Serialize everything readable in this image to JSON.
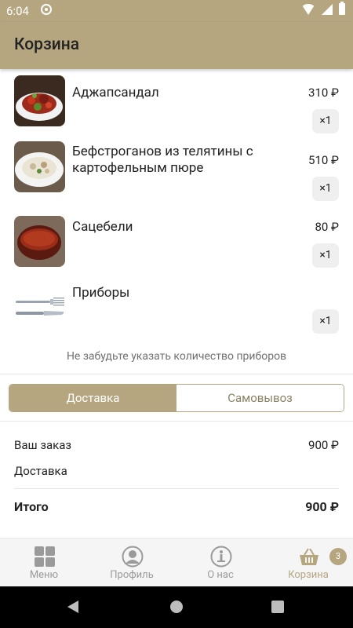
{
  "status_bar": {
    "time": "6:04"
  },
  "header": {
    "title": "Корзина"
  },
  "cart": {
    "items": [
      {
        "name": "Аджапсандал",
        "price": "310 ₽",
        "qty": "×1",
        "image": "ajapsandal-dish"
      },
      {
        "name": "Бефстроганов из телятины с картофельным пюре",
        "price": "510 ₽",
        "qty": "×1",
        "image": "beef-stroganoff-dish"
      },
      {
        "name": "Сацебели",
        "price": "80 ₽",
        "qty": "×1",
        "image": "satsebeli-sauce"
      },
      {
        "name": "Приборы",
        "price": "",
        "qty": "×1",
        "image": "cutlery"
      }
    ],
    "cutlery_note": "Не забудьте указать количество приборов"
  },
  "delivery_toggle": {
    "options": [
      "Доставка",
      "Самовывоз"
    ],
    "selected": "Доставка"
  },
  "summary": {
    "order_label": "Ваш заказ",
    "order_value": "900 ₽",
    "delivery_label": "Доставка",
    "delivery_value": "",
    "total_label": "Итого",
    "total_value": "900 ₽"
  },
  "bottom_nav": {
    "items": [
      {
        "label": "Меню",
        "icon": "menu-grid-icon",
        "active": false
      },
      {
        "label": "Профиль",
        "icon": "profile-icon",
        "active": false
      },
      {
        "label": "О нас",
        "icon": "info-icon",
        "active": false
      },
      {
        "label": "Корзина",
        "icon": "basket-icon",
        "active": true
      }
    ],
    "cart_badge": "3"
  },
  "colors": {
    "accent": "#b5a680",
    "nav_inactive": "#9a9a9a",
    "nav_active": "#b5a680"
  }
}
